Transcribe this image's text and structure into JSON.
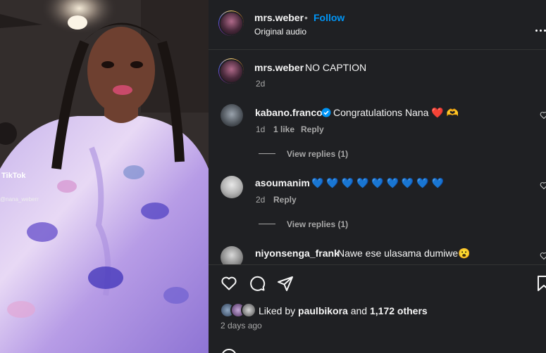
{
  "post": {
    "username": "mrs.weber",
    "separator": "•",
    "follow_label": "Follow",
    "audio": "Original audio",
    "caption_user": "mrs.weber",
    "caption_text": "NO CAPTION",
    "caption_time": "2d"
  },
  "media": {
    "watermark": "TikTok",
    "watermark_user": "@nana_weberr"
  },
  "comments": [
    {
      "username": "kabano.franco",
      "verified": true,
      "text": "Congratulations Nana ❤️ 🫶",
      "time": "1d",
      "likes": "1 like",
      "reply_label": "Reply",
      "view_replies": "View replies (1)"
    },
    {
      "username": "asoumanim",
      "verified": false,
      "text": "💙 💙 💙 💙 💙 💙 💙 💙 💙",
      "time": "2d",
      "reply_label": "Reply",
      "view_replies": "View replies (1)"
    },
    {
      "username": "niyonsenga_frank",
      "verified": false,
      "text": "Nawe ese ulasama dumiwe😮"
    }
  ],
  "likes": {
    "prefix": "Liked by",
    "user": "paulbikora",
    "and": "and",
    "others": "1,172 others",
    "time": "2 days ago"
  },
  "icons": {
    "more": "more-options-icon",
    "like": "heart-icon",
    "comment": "comment-icon",
    "share": "share-icon",
    "save": "bookmark-icon",
    "verified": "verified-badge-icon"
  },
  "colors": {
    "panel_bg": "#1f2023",
    "follow_blue": "#0095f6",
    "verified_blue": "#0095f6"
  }
}
